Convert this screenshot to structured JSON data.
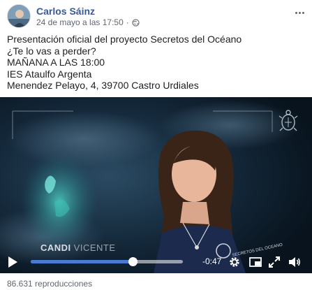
{
  "post": {
    "author": "Carlos Sáinz",
    "timestamp": "24 de mayo a las 17:50",
    "separator": "·",
    "privacy_icon": "globe-icon",
    "text_lines": [
      "Presentación oficial del proyecto Secretos del Océano",
      "¿Te lo vas a perder?",
      "MAÑANA A LAS 18:00",
      "IES Ataulfo Argenta",
      "Menendez Pelayo, 4, 39700 Castro Urdiales"
    ]
  },
  "video": {
    "overlay_name_first": "CANDI",
    "overlay_name_last": "VICENTE",
    "time_remaining": "-0:47",
    "progress": 0.67,
    "logo_icon": "turtle-logo-icon",
    "shirt_text": "SECRETOS DEL OCEANO"
  },
  "footer": {
    "views": "86.631 reproducciones"
  },
  "colors": {
    "author": "#385898",
    "seek_fill": "#4a7bd0",
    "meta": "#606770"
  }
}
